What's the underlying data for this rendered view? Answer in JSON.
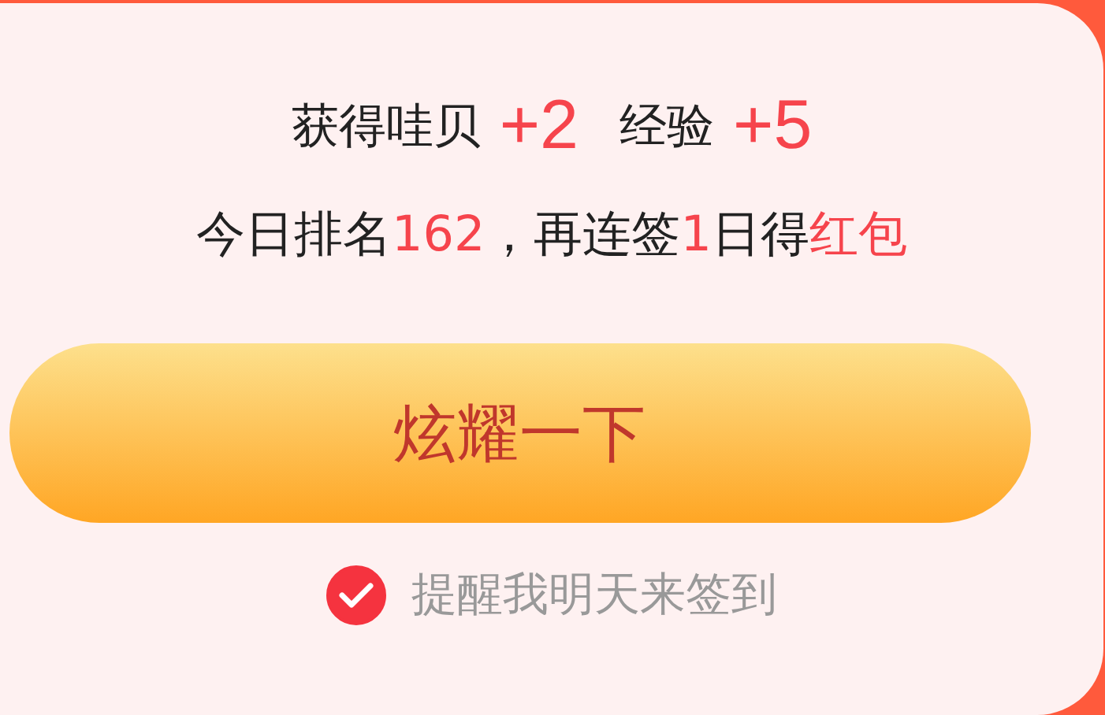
{
  "rewards": [
    {
      "label": "获得哇贝",
      "value": "+2"
    },
    {
      "label": "经验",
      "value": "+5"
    }
  ],
  "streak_message": [
    {
      "text": "今日排名",
      "highlight": false
    },
    {
      "text": "162",
      "highlight": true
    },
    {
      "text": "，再连签",
      "highlight": false
    },
    {
      "text": "1",
      "highlight": true
    },
    {
      "text": "日得",
      "highlight": false
    },
    {
      "text": "红包",
      "highlight": true
    }
  ],
  "share_button": "炫耀一下",
  "reminder": {
    "label": "提醒我明天来签到",
    "checked": true
  }
}
